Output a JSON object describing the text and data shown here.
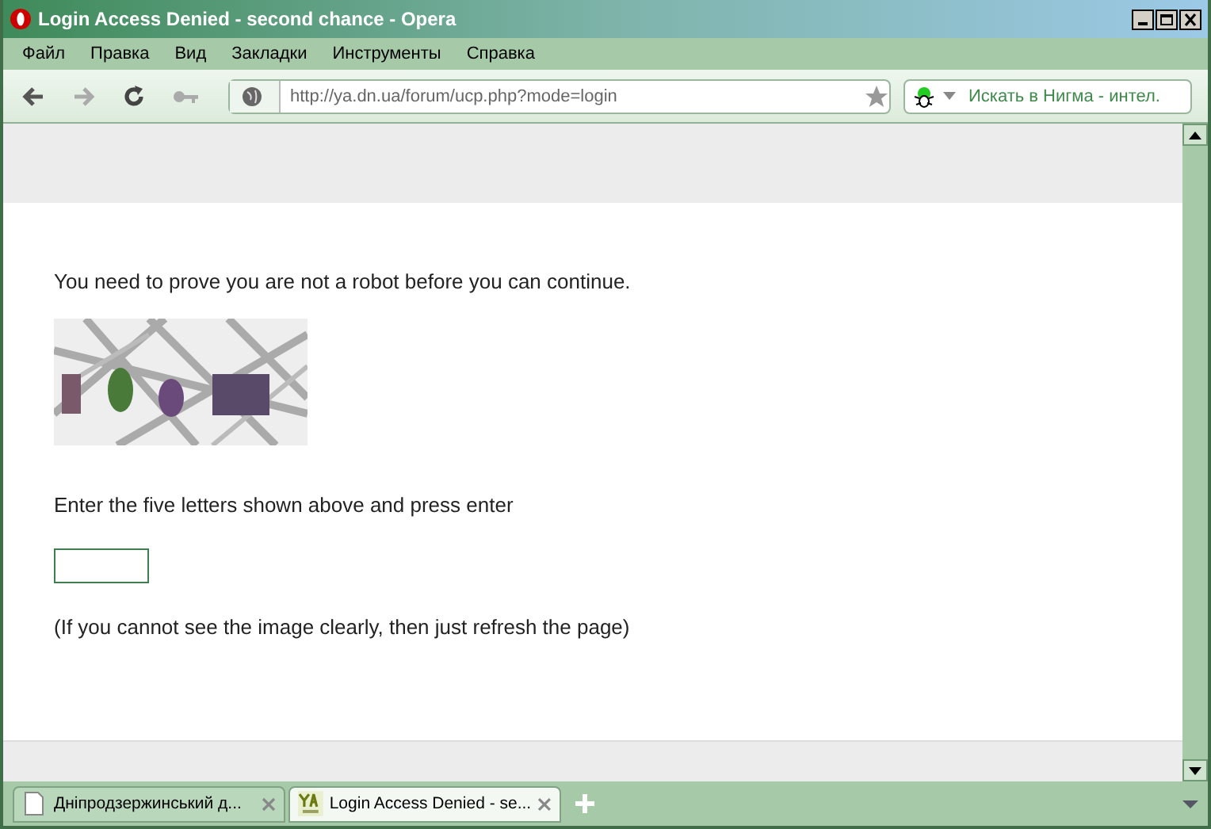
{
  "window": {
    "title": "Login Access Denied - second chance - Opera"
  },
  "menu": [
    "Файл",
    "Правка",
    "Вид",
    "Закладки",
    "Инструменты",
    "Справка"
  ],
  "toolbar": {
    "address": "http://ya.dn.ua/forum/ucp.php?mode=login",
    "search_placeholder": "Искать в Нигма - интел."
  },
  "page": {
    "intro": "You need to prove you are not a robot before you can continue.",
    "instruction": "Enter the five letters shown above and press enter",
    "note": "(If you cannot see the image clearly, then just refresh the page)"
  },
  "tabs": [
    {
      "label": "Дніпродзержинський д...",
      "selected": false
    },
    {
      "label": "Login Access Denied - se...",
      "selected": true
    }
  ]
}
